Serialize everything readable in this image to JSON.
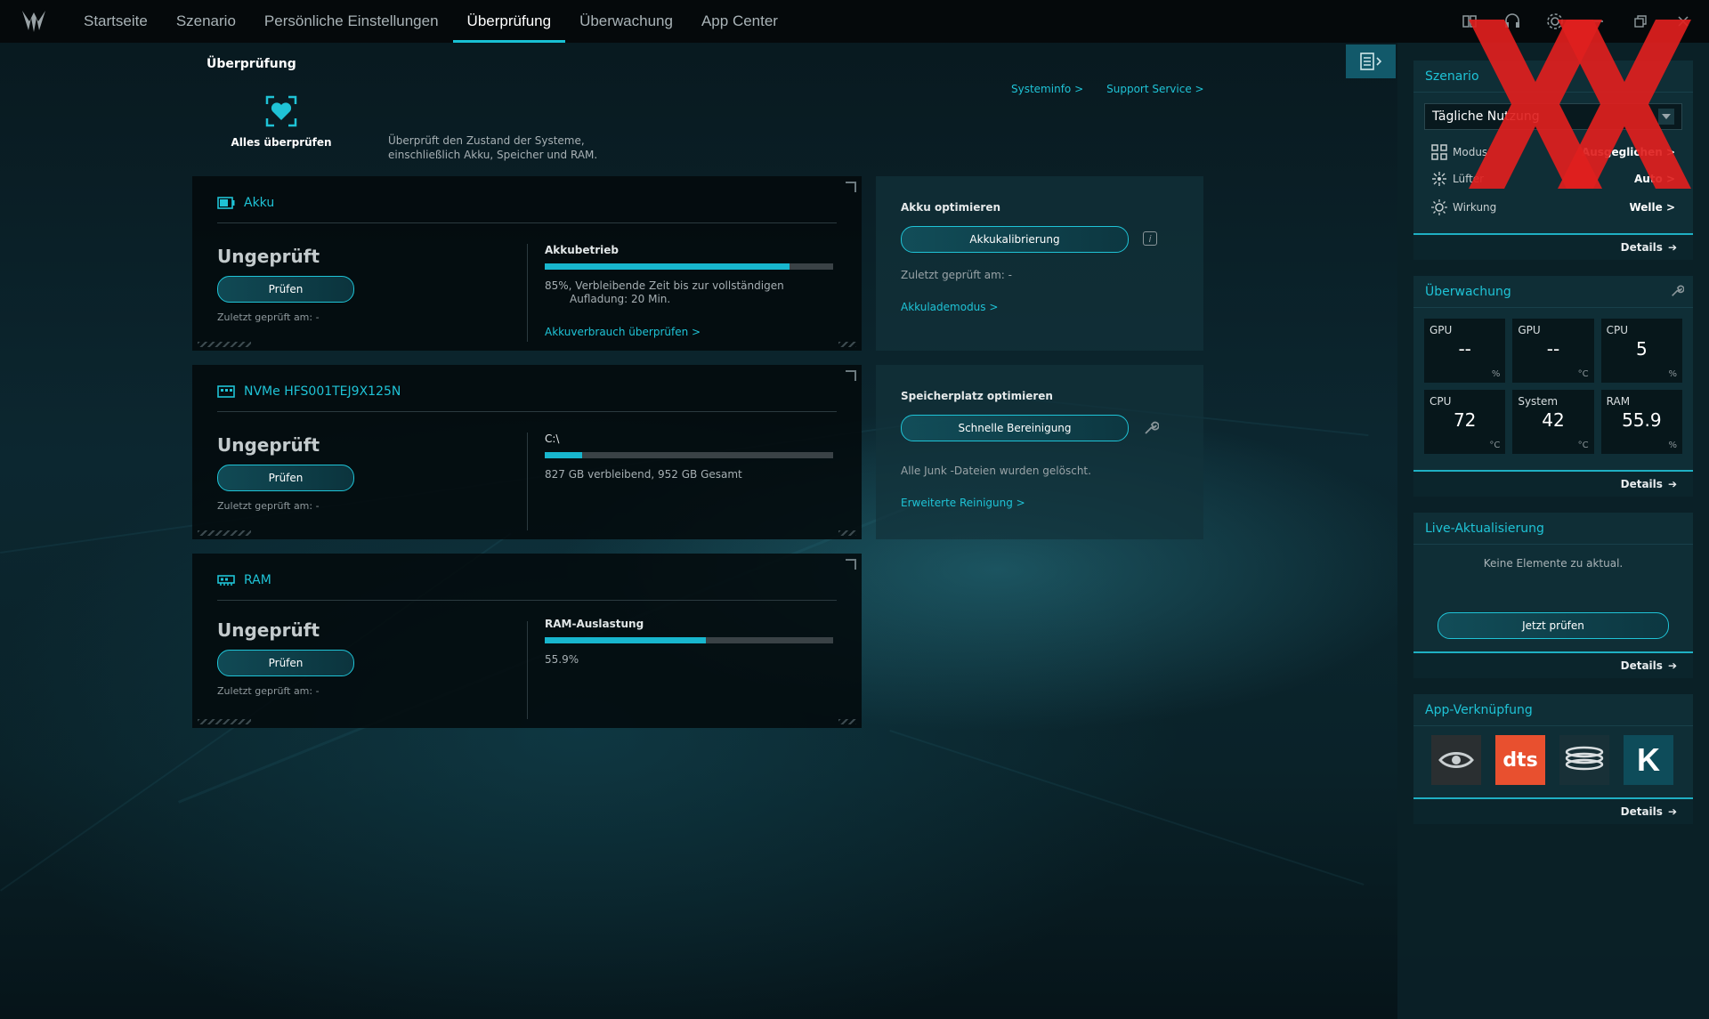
{
  "nav": {
    "items": [
      "Startseite",
      "Szenario",
      "Persönliche Einstellungen",
      "Überprüfung",
      "Überwachung",
      "App Center"
    ],
    "active": "Überprüfung"
  },
  "page": {
    "title": "Überprüfung",
    "links": [
      "Systeminfo >",
      "Support Service >"
    ],
    "check_all_label": "Alles überprüfen",
    "check_all_desc_1": "Überprüft den Zustand der Systeme,",
    "check_all_desc_2": "einschließlich Akku, Speicher und RAM."
  },
  "cards": {
    "akku": {
      "title": "Akku",
      "status": "Ungeprüft",
      "button": "Prüfen",
      "last": "Zuletzt geprüft am: -",
      "metric_label": "Akkubetrieb",
      "percent": 85,
      "text_1": "85%, Verbleibende Zeit bis zur vollständigen",
      "text_2": "Aufladung: 20 Min.",
      "link": "Akkuverbrauch überprüfen >"
    },
    "nvme": {
      "title": "NVMe HFS001TEJ9X125N",
      "status": "Ungeprüft",
      "button": "Prüfen",
      "last": "Zuletzt geprüft am: -",
      "metric_label": "C:\\",
      "percent": 13,
      "text_1": "827 GB verbleibend, 952 GB Gesamt"
    },
    "ram": {
      "title": "RAM",
      "status": "Ungeprüft",
      "button": "Prüfen",
      "last": "Zuletzt geprüft am: -",
      "metric_label": "RAM-Auslastung",
      "percent": 55.9,
      "text_1": "55.9%"
    }
  },
  "optimize": {
    "akku": {
      "title": "Akku optimieren",
      "button": "Akkukalibrierung",
      "last": "Zuletzt geprüft am: -",
      "link": "Akkulademodus >"
    },
    "storage": {
      "title": "Speicherplatz optimieren",
      "button": "Schnelle Bereinigung",
      "text": "Alle Junk -Dateien wurden gelöscht.",
      "link": "Erweiterte Reinigung >"
    }
  },
  "right": {
    "scenario": {
      "title": "Szenario",
      "selected": "Tägliche Nutzung",
      "rows": [
        {
          "label": "Modus",
          "value": "Ausgeglichen >"
        },
        {
          "label": "Lüfter",
          "value": "Auto >"
        },
        {
          "label": "Wirkung",
          "value": "Welle >"
        }
      ],
      "details": "Details"
    },
    "monitor": {
      "title": "Überwachung",
      "cells": [
        {
          "name": "GPU",
          "value": "--",
          "unit": "%"
        },
        {
          "name": "GPU",
          "value": "--",
          "unit": "°C"
        },
        {
          "name": "CPU",
          "value": "5",
          "unit": "%"
        },
        {
          "name": "CPU",
          "value": "72",
          "unit": "°C"
        },
        {
          "name": "System",
          "value": "42",
          "unit": "°C"
        },
        {
          "name": "RAM",
          "value": "55.9",
          "unit": "%"
        }
      ],
      "details": "Details"
    },
    "live": {
      "title": "Live-Aktualisierung",
      "text": "Keine Elemente zu aktual.",
      "button": "Jetzt prüfen",
      "details": "Details"
    },
    "apps": {
      "title": "App-Verknüpfung",
      "dts_label": "dts",
      "k_label": "K",
      "details": "Details"
    }
  },
  "colors": {
    "accent": "#1fc3d6",
    "overlay_x": "#e0201e",
    "dts_tile": "#e8502f"
  }
}
